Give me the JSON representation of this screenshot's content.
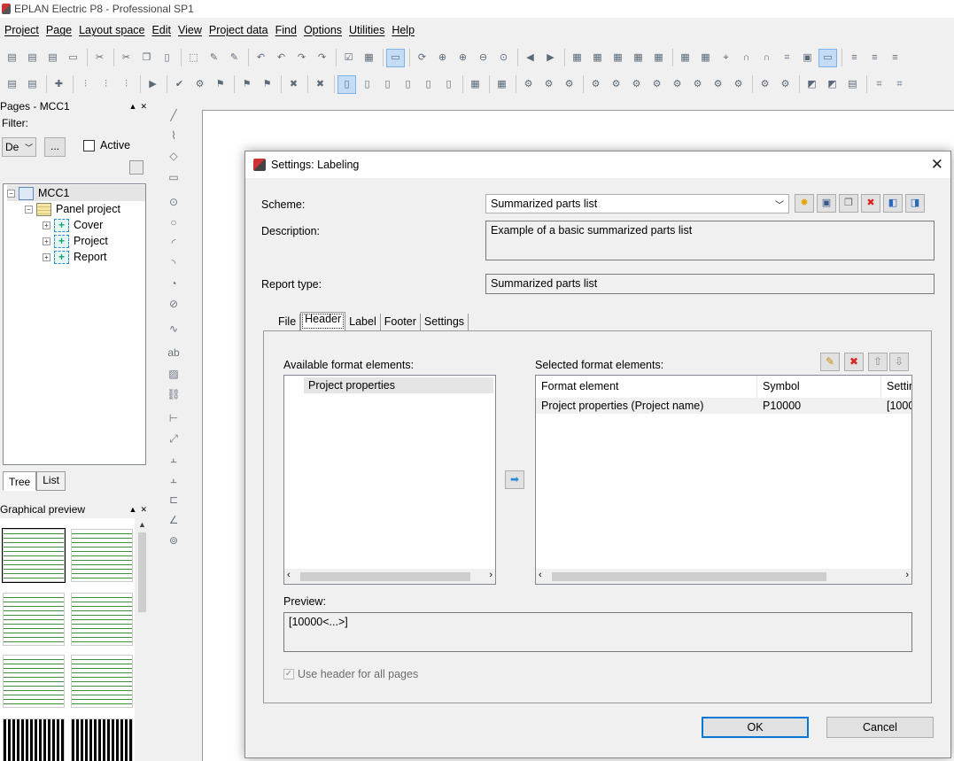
{
  "app": {
    "title": "EPLAN Electric P8 - Professional SP1",
    "icon": "eplan-app-icon"
  },
  "menu": [
    "Project",
    "Page",
    "Layout space",
    "Edit",
    "View",
    "Project data",
    "Find",
    "Options",
    "Utilities",
    "Help"
  ],
  "pages_panel": {
    "title": "Pages - MCC1",
    "filter_label": "Filter:",
    "filter_value": "De",
    "filter_button": "...",
    "active_label": "Active",
    "tree": [
      {
        "label": "MCC1",
        "icon": "project-icon",
        "selected": true
      },
      {
        "label": "Panel project",
        "icon": "folder-icon"
      },
      {
        "label": "Cover",
        "icon": "page-icon"
      },
      {
        "label": "Project",
        "icon": "page-icon"
      },
      {
        "label": "Report",
        "icon": "page-icon"
      }
    ],
    "tabs": [
      "Tree",
      "List"
    ]
  },
  "preview_panel": {
    "title": "Graphical preview"
  },
  "dialog": {
    "title": "Settings: Labeling",
    "close_glyph": "✕",
    "scheme_label": "Scheme:",
    "scheme_value": "Summarized parts list",
    "description_label": "Description:",
    "description_value": "Example of a basic summarized parts list",
    "report_type_label": "Report type:",
    "report_type_value": "Summarized parts list",
    "tabs": [
      "File",
      "Header",
      "Label",
      "Footer",
      "Settings"
    ],
    "active_tab": "Header",
    "available_label": "Available format elements:",
    "available_items": [
      "Project properties"
    ],
    "selected_label": "Selected format elements:",
    "columns": [
      "Format element",
      "Symbol",
      "Settir"
    ],
    "rows": [
      {
        "element": "Project properties (Project name)",
        "symbol": "P10000",
        "setting": "[1000"
      }
    ],
    "preview_label": "Preview:",
    "preview_value": "[10000<...>]",
    "use_header_label": "Use header for all pages",
    "use_header_checked": true,
    "ok_label": "OK",
    "cancel_label": "Cancel"
  }
}
